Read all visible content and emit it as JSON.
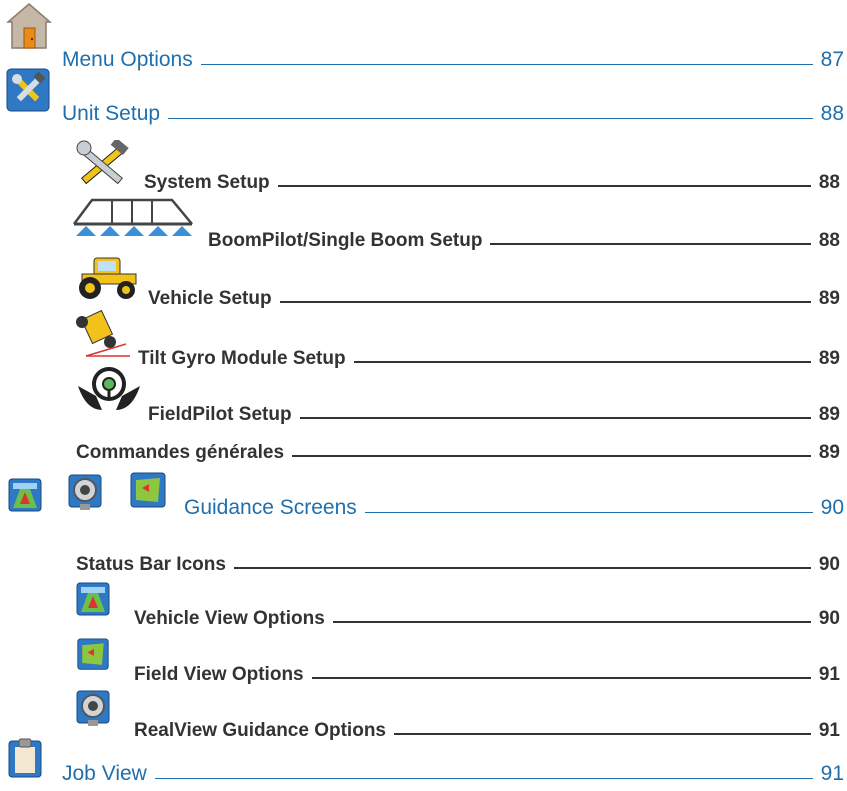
{
  "entries": [
    {
      "label": "Menu Options",
      "page": "87",
      "icon": "home-icon"
    },
    {
      "label": "Unit Setup",
      "page": "88",
      "icon": "tools-icon"
    },
    {
      "label": "System Setup",
      "page": "88",
      "icon": "wrench-hammer-icon"
    },
    {
      "label": "BoomPilot/Single Boom Setup",
      "page": "88",
      "icon": "boom-sprayer-icon"
    },
    {
      "label": "Vehicle Setup",
      "page": "89",
      "icon": "tractor-icon"
    },
    {
      "label": "Tilt Gyro Module Setup",
      "page": "89",
      "icon": "tilt-gyro-icon"
    },
    {
      "label": "FieldPilot Setup",
      "page": "89",
      "icon": "steering-wheel-hands-icon"
    },
    {
      "label": "Commandes générales",
      "page": "89"
    },
    {
      "label": "Guidance Screens",
      "page": "90",
      "icons": [
        "vehicle-view-icon",
        "realview-camera-icon",
        "field-view-icon"
      ]
    },
    {
      "label": "Status Bar Icons",
      "page": "90"
    },
    {
      "label": "Vehicle View Options",
      "page": "90",
      "icon": "vehicle-view-icon"
    },
    {
      "label": "Field View Options",
      "page": "91",
      "icon": "field-view-icon"
    },
    {
      "label": "RealView Guidance Options",
      "page": "91",
      "icon": "realview-camera-icon"
    },
    {
      "label": "Job View",
      "page": "91",
      "icon": "clipboard-icon"
    }
  ]
}
